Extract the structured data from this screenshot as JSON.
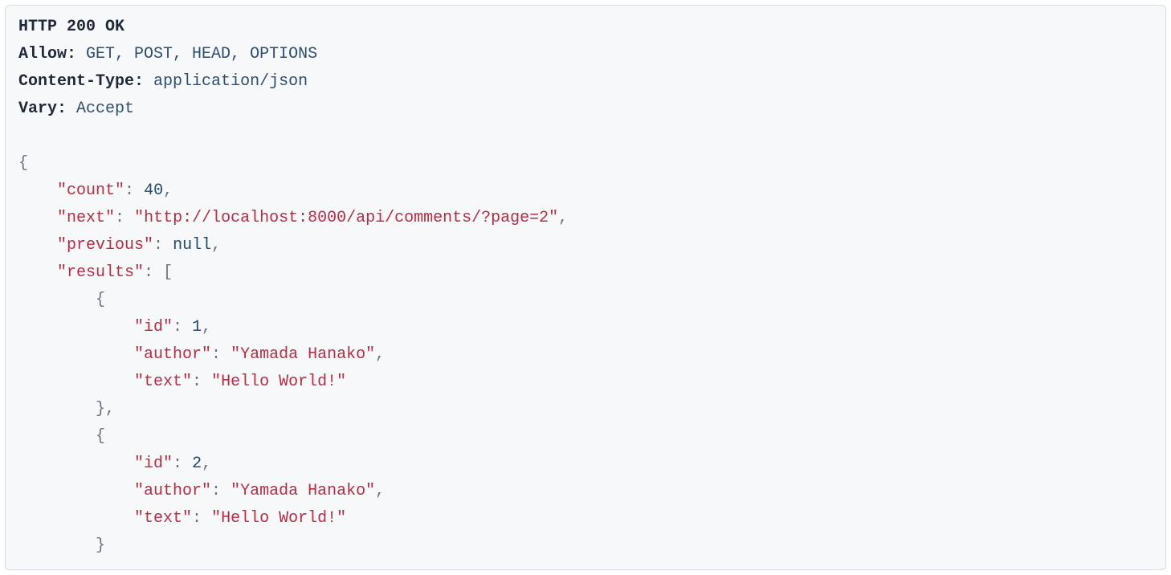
{
  "status_line": "HTTP 200 OK",
  "headers": [
    {
      "name": "Allow",
      "value": "GET, POST, HEAD, OPTIONS"
    },
    {
      "name": "Content-Type",
      "value": "application/json"
    },
    {
      "name": "Vary",
      "value": "Accept"
    }
  ],
  "body": {
    "count": 40,
    "next": "http://localhost:8000/api/comments/?page=2",
    "previous": null,
    "results": [
      {
        "id": 1,
        "author": "Yamada Hanako",
        "text": "Hello World!"
      },
      {
        "id": 2,
        "author": "Yamada Hanako",
        "text": "Hello World!"
      }
    ]
  }
}
